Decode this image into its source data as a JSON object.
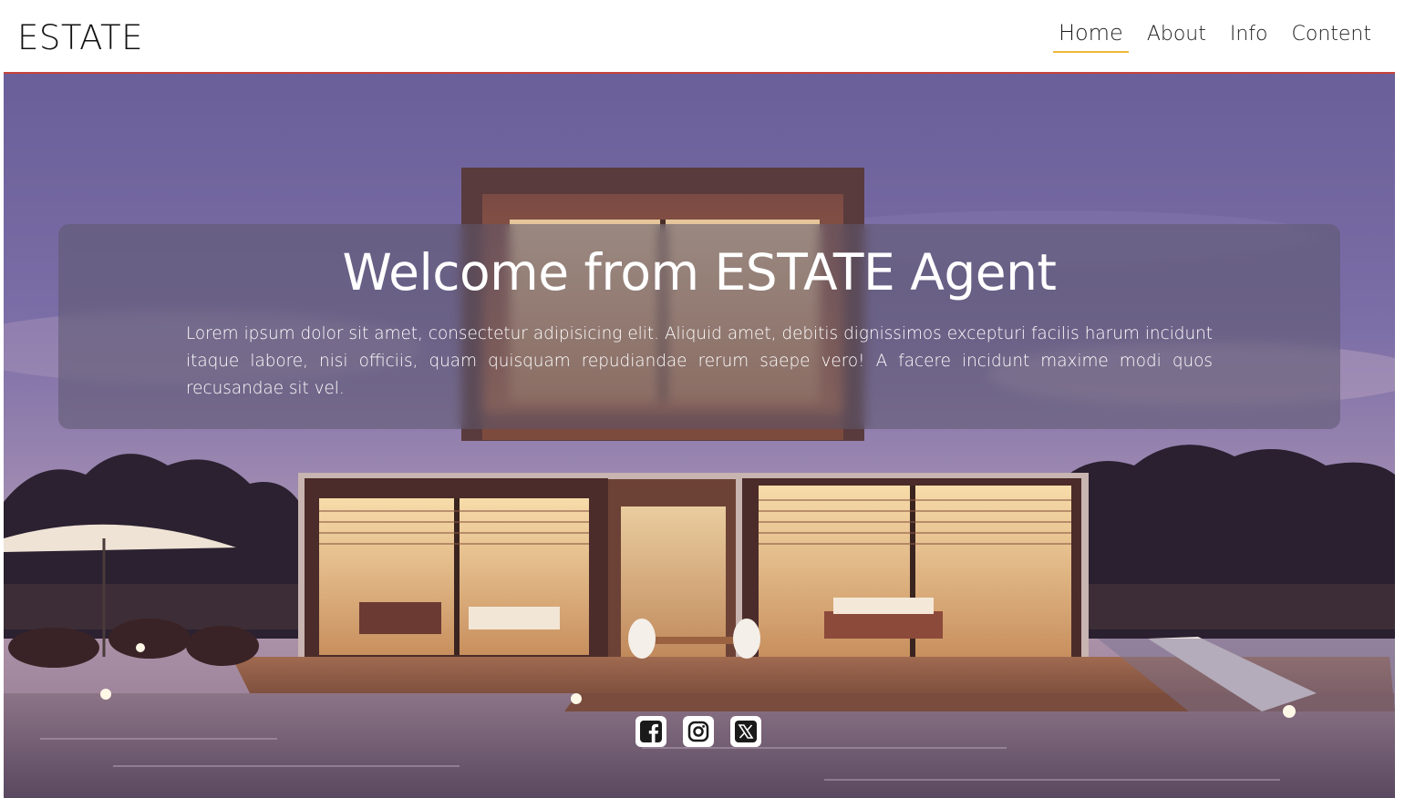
{
  "header": {
    "logo": "ESTATE",
    "nav": [
      {
        "label": "Home",
        "active": true
      },
      {
        "label": "About",
        "active": false
      },
      {
        "label": "Info",
        "active": false
      },
      {
        "label": "Content",
        "active": false
      }
    ],
    "accent_underline": "#f0b73a",
    "divider_color": "#c9433a"
  },
  "hero": {
    "title": "Welcome from ESTATE Agent",
    "body": "Lorem ipsum dolor sit amet, consectetur adipisicing elit. Aliquid amet, debitis dignissimos excepturi facilis harum incidunt itaque labore, nisi officiis, quam quisquam repudiandae rerum saepe vero! A facere incidunt maxime modi quos recusandae sit vel.",
    "background": "modern-house-pool-dusk-photo"
  },
  "social": [
    {
      "icon": "facebook-icon"
    },
    {
      "icon": "instagram-icon"
    },
    {
      "icon": "x-twitter-icon"
    }
  ]
}
